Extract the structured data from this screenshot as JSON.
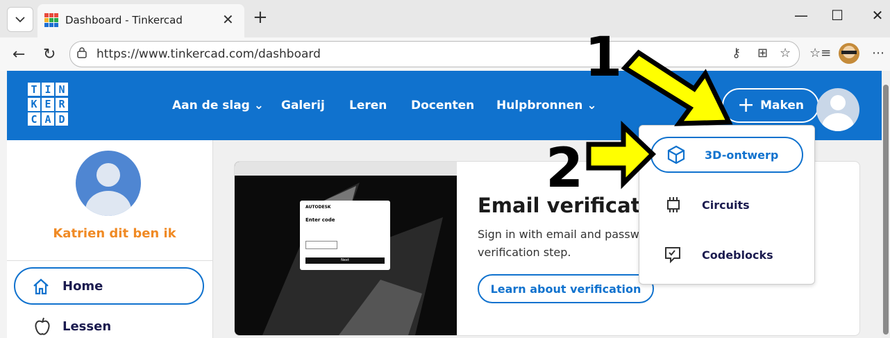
{
  "browser": {
    "tab_title": "Dashboard - Tinkercad",
    "url": "https://www.tinkercad.com/dashboard",
    "icons": [
      "tab-list-icon",
      "close-tab-icon",
      "new-tab-icon",
      "minimize-icon",
      "maximize-icon",
      "close-window-icon",
      "back-icon",
      "refresh-icon",
      "lock-icon",
      "key-icon",
      "extensions-icon",
      "favorite-icon",
      "favorites-list-icon",
      "profile-icon",
      "more-icon"
    ]
  },
  "header": {
    "logo_letters": [
      "T",
      "I",
      "N",
      "K",
      "E",
      "R",
      "C",
      "A",
      "D"
    ],
    "nav": [
      "Aan de slag",
      "Galerij",
      "Leren",
      "Docenten",
      "Hulpbronnen"
    ],
    "make_label": "Maken"
  },
  "dropdown": {
    "items": [
      "3D-ontwerp",
      "Circuits",
      "Codeblocks"
    ]
  },
  "sidebar": {
    "username": "Katrien dit ben ik",
    "home_label": "Home",
    "lessons_label": "Lessen"
  },
  "card": {
    "title": "Email verificatio",
    "text_line1": "Sign in with email and passw",
    "text_line2": "verification step.",
    "button": "Learn about verification",
    "image": {
      "brand": "AUTODESK",
      "heading": "Enter code",
      "button": "Next"
    }
  },
  "annotations": {
    "step1": "1",
    "step2": "2",
    "arrow_color": "#ffff00"
  },
  "colors": {
    "brand_blue": "#1072ce",
    "username_orange": "#f08a24"
  }
}
